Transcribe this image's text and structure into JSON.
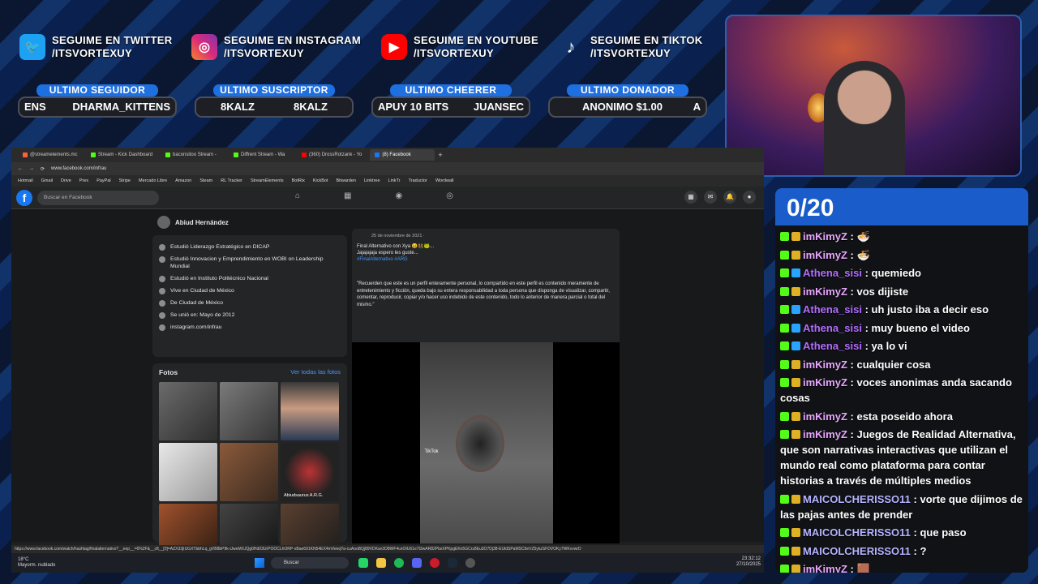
{
  "socials": [
    {
      "line1": "SEGUIME EN TWITTER",
      "line2": "/ITSVORTEXUY",
      "icon": "twitter-icon",
      "color": "#1da1f2"
    },
    {
      "line1": "SEGUIME EN INSTAGRAM",
      "line2": "/ITSVORTEXUY",
      "icon": "instagram-icon",
      "color": "#d6249f"
    },
    {
      "line1": "SEGUIME EN YOUTUBE",
      "line2": "/ITSVORTEXUY",
      "icon": "youtube-icon",
      "color": "#ff0000"
    },
    {
      "line1": "SEGUIME EN TIKTOK",
      "line2": "/ITSVORTEXUY",
      "icon": "tiktok-icon",
      "color": "#111111"
    }
  ],
  "stats": [
    {
      "label": "ULTIMO SEGUIDOR",
      "left": "ENS",
      "right": "DHARMA_KITTENS"
    },
    {
      "label": "ULTIMO SUSCRIPTOR",
      "left": "8KALZ",
      "right": "8KALZ"
    },
    {
      "label": "ULTIMO CHEERER",
      "left": "APUY 10 BITS",
      "right": "JUANSEC"
    },
    {
      "label": "ULTIMO DONADOR",
      "left": "ANONIMO $1.00",
      "right": "A"
    }
  ],
  "browser": {
    "tabs": [
      "@streamelements.mc",
      "Stream - Kick Dashboard",
      "baconsitoo Stream -",
      "Diffrent Stream - Wa",
      "(360) DrossRotzank - Yo",
      "(8) Facebook"
    ],
    "url": "www.facebook.com/infrau",
    "bookmarks": [
      "Hotmail",
      "Gmail",
      "Drive",
      "Prex",
      "PayPal",
      "Stripe",
      "Mercado Libre",
      "Amazon",
      "Steam",
      "RL Tracker",
      "StreamElements",
      "BotRix",
      "KickBot",
      "Bitwarden",
      "Linktree",
      "LinkTr",
      "Traductor",
      "Wordwall"
    ],
    "search_placeholder": "Buscar en Facebook",
    "status_url": "https://www.facebook.com/watch/hashtag/finalalternativo?__eep__=6%2F&__cft__[0]=AZX33jIUGXTbbhLq_gVB8bP9k-iJweMXJQg0Hd03UrPOOCLhORP-xBae691KN54EX4mVeeqYa-cuAooBQj89VDKxe3O8WF4ceOIU61e7t3wAR82PbxXPKpgEKn5GCrz8Eu3O7Dj38-EUldSPaMSC6eVZ5ykzSFDVOKy7WKvvwrD"
  },
  "profile": {
    "name": "Abiud Hernández",
    "intro": [
      "Estudió Liderazgo Estratégico en DICAP",
      "Estudió Innovacion y Emprendimiento en WOBI on Leadership Mundial",
      "Estudió en Instituto Politécnico Nacional",
      "Vive en Ciudad de México",
      "De Ciudad de México",
      "Se unió en: Mayo de 2012",
      "instagram.com/infrau"
    ],
    "photos_title": "Fotos",
    "photos_link": "Ver todas las fotos",
    "photo_caption": "Abiudsaurus A.R.G."
  },
  "post": {
    "date": "25 de noviembre de 2021 · ",
    "line1": "Final Alternativo con Xya 😀👯‍♂️🐸...",
    "line2": "Jajajajaja espero les guste...",
    "tags": "#FinalAlternativo #ARG",
    "disclaimer": "\"Recuerden que este es un perfil enteramente personal, lo compartido en este perfil es contenido meramente de entretenimiento y ficción, queda bajo su entera responsabilidad a toda persona que disponga de visualizar, compartir, comentar, reproducir, copiar y/o hacer uso indebido de este contenido, todo lo anterior de manera parcial o total del mismo.\"",
    "video_label": "TikTok"
  },
  "taskbar": {
    "weather_temp": "18°C",
    "weather_text": "Mayorm. nublado",
    "search": "Buscar",
    "lang": "ESP LAA",
    "time": "23:32:12",
    "date": "27/10/2025"
  },
  "chat": {
    "counter": "0/20",
    "messages": [
      {
        "user": "imKimyZ",
        "text": ": 🍜",
        "style": "a"
      },
      {
        "user": "imKimyZ",
        "text": ": 🍜",
        "style": "a"
      },
      {
        "user": "Athena_sisi",
        "text": ": quemiedo",
        "style": "b"
      },
      {
        "user": "imKimyZ",
        "text": ": vos dijiste",
        "style": "a"
      },
      {
        "user": "Athena_sisi",
        "text": ": uh justo iba a decir eso",
        "style": "b"
      },
      {
        "user": "Athena_sisi",
        "text": ": muy bueno el video",
        "style": "b"
      },
      {
        "user": "Athena_sisi",
        "text": ": ya lo vi",
        "style": "b"
      },
      {
        "user": "imKimyZ",
        "text": ": cualquier cosa",
        "style": "a"
      },
      {
        "user": "imKimyZ",
        "text": ": voces anonimas anda sacando cosas",
        "style": "a"
      },
      {
        "user": "imKimyZ",
        "text": ": esta poseido ahora",
        "style": "a"
      },
      {
        "user": "imKimyZ",
        "text": ": Juegos de Realidad Alternativa, que son narrativas interactivas que utilizan el mundo real como plataforma para contar historias a través de múltiples medios",
        "style": "a"
      },
      {
        "user": "MAICOLCHERISSO11",
        "text": ": vorte que dijimos de las pajas antes de prender",
        "style": "c"
      },
      {
        "user": "MAICOLCHERISSO11",
        "text": ": que paso",
        "style": "c"
      },
      {
        "user": "MAICOLCHERISSO11",
        "text": ": ?",
        "style": "c"
      },
      {
        "user": "imKimyZ",
        "text": ": 🟫",
        "style": "a"
      }
    ]
  }
}
